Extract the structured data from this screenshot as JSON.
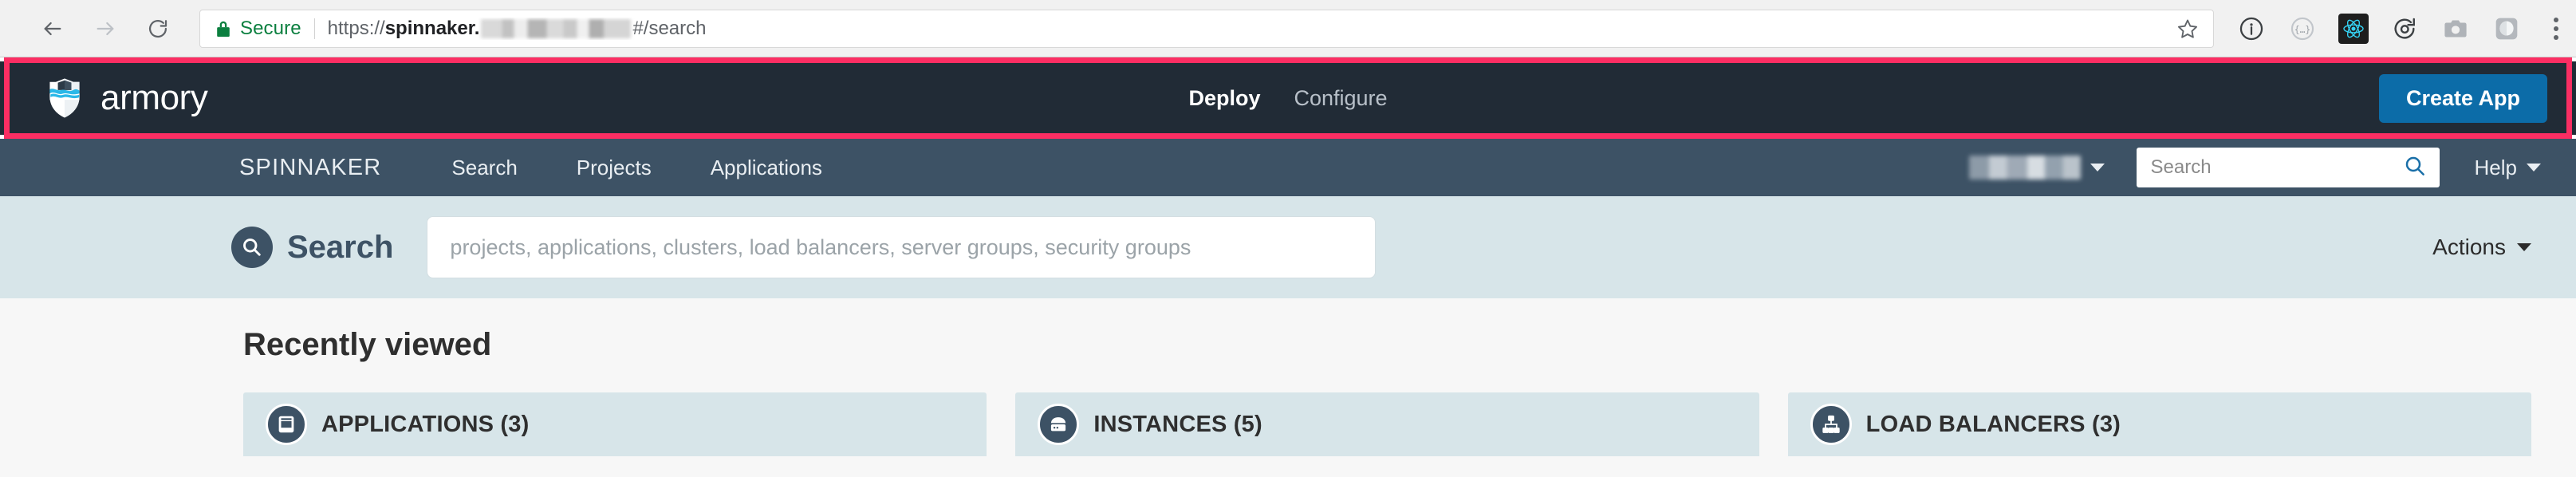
{
  "browser": {
    "back_label": "Back",
    "forward_label": "Forward",
    "reload_label": "Reload",
    "security_label": "Secure",
    "url_scheme": "https://",
    "url_host": "spinnaker.",
    "url_redacted": "[redacted]",
    "url_path": "#/search",
    "bookmark_label": "Bookmark this page",
    "extensions": [
      {
        "name": "info-circle-icon",
        "label": ""
      },
      {
        "name": "braces-circle-icon",
        "label": ""
      },
      {
        "name": "react-devtools-icon",
        "label": ""
      },
      {
        "name": "camera-refresh-icon",
        "label": ""
      },
      {
        "name": "screenshot-camera-icon",
        "label": ""
      },
      {
        "name": "shield-extension-icon",
        "label": ""
      }
    ],
    "menu_label": "Customize and control"
  },
  "armory_header": {
    "brand": "armory",
    "nav": [
      {
        "label": "Deploy",
        "active": true
      },
      {
        "label": "Configure",
        "active": false
      }
    ],
    "create_app_label": "Create App",
    "accent_color": "#0C6CA8",
    "background_color": "#212B36",
    "highlight_color": "#FB2E63"
  },
  "spinnaker_nav": {
    "brand": "SPINNAKER",
    "links": [
      {
        "label": "Search"
      },
      {
        "label": "Projects"
      },
      {
        "label": "Applications"
      }
    ],
    "user_name": "[redacted]",
    "search_placeholder": "Search",
    "search_value": "",
    "help_label": "Help",
    "background_color": "#3D5265"
  },
  "search_panel": {
    "icon": "search-icon",
    "title": "Search",
    "input_placeholder": "projects, applications, clusters, load balancers, server groups, security groups",
    "input_value": "",
    "actions_label": "Actions",
    "background_color": "#D7E5E9"
  },
  "results": {
    "section_title": "Recently viewed",
    "cards": [
      {
        "icon": "applications-icon",
        "label": "APPLICATIONS (3)"
      },
      {
        "icon": "instances-icon",
        "label": "INSTANCES (5)"
      },
      {
        "icon": "load-balancers-icon",
        "label": "LOAD BALANCERS (3)"
      }
    ]
  }
}
